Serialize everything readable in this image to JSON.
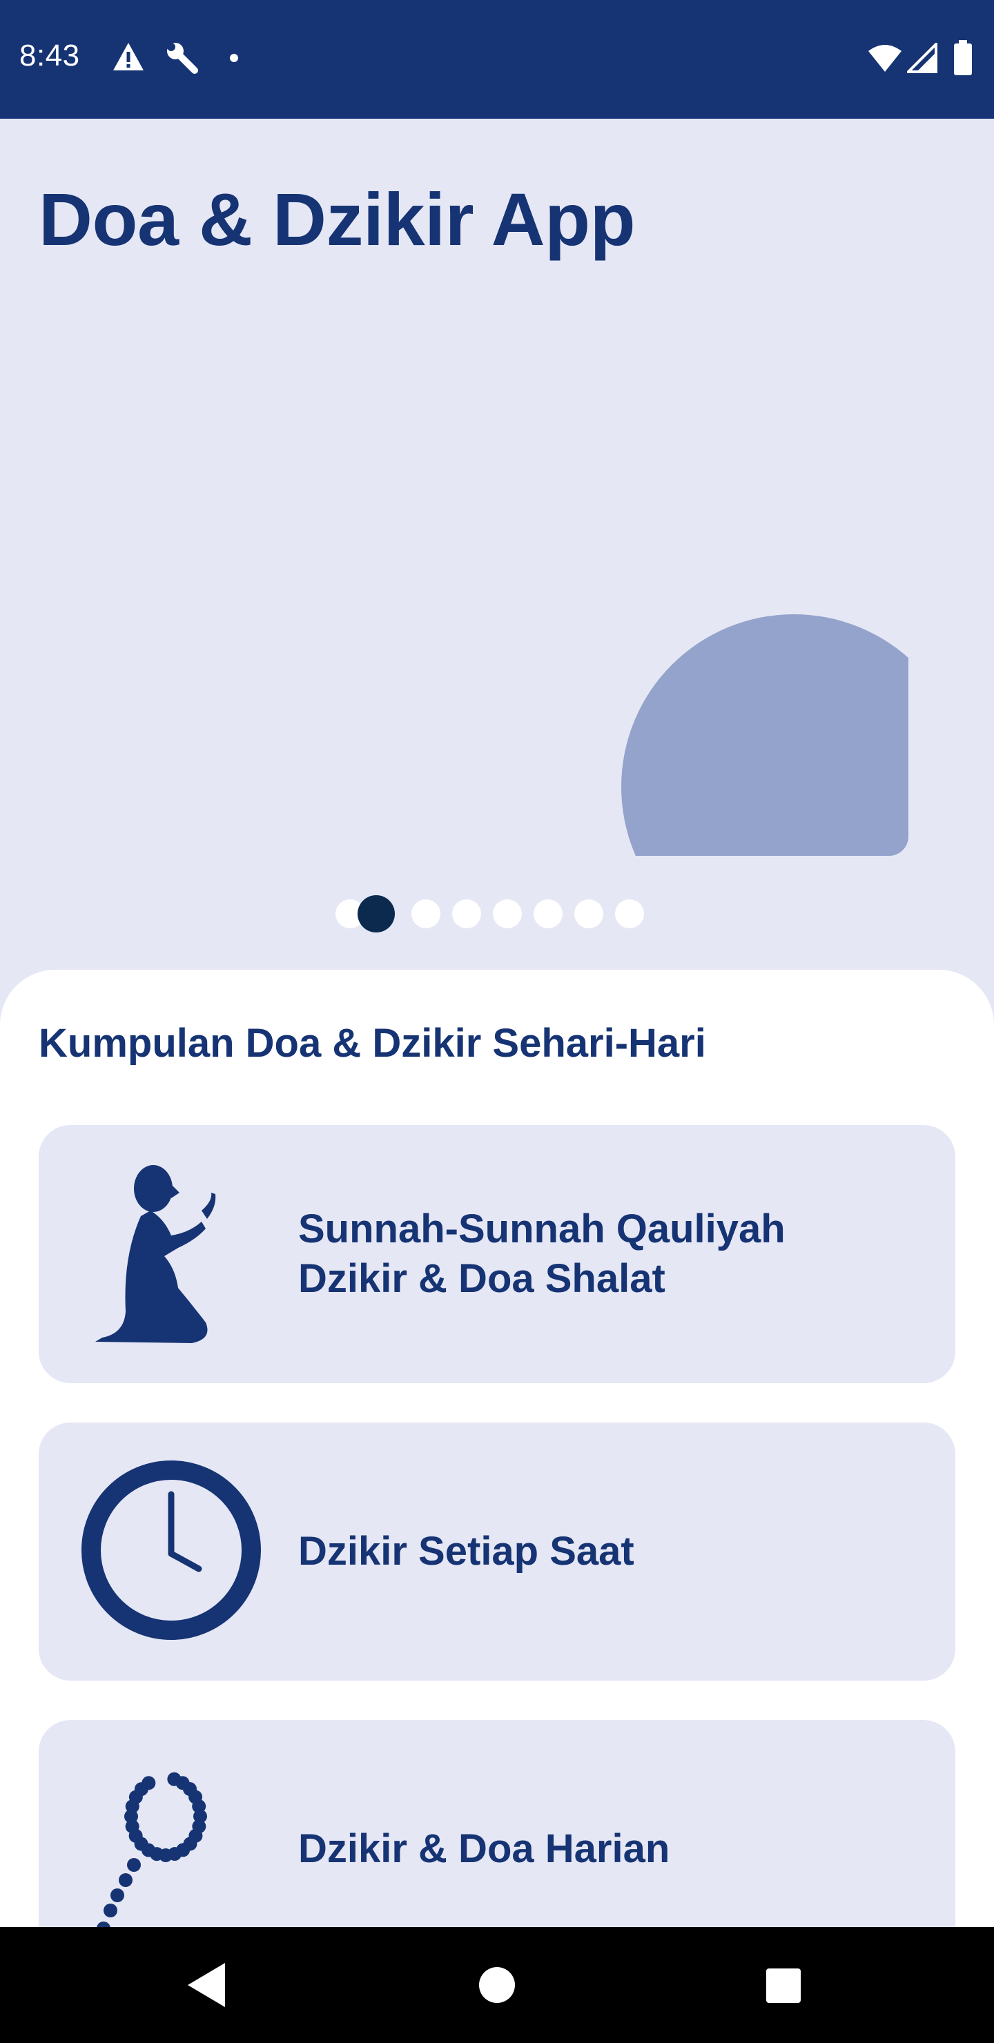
{
  "status_bar": {
    "time": "8:43",
    "left_icons": [
      "warning-icon",
      "wrench-icon",
      "dot-icon"
    ],
    "right_icons": [
      "wifi-icon",
      "signal-icon",
      "battery-icon"
    ]
  },
  "header": {
    "title": "Doa & Dzikir App"
  },
  "carousel": {
    "total_pages": 8,
    "active_index": 1
  },
  "section": {
    "title": "Kumpulan Doa & Dzikir Sehari-Hari"
  },
  "cards": [
    {
      "icon": "praying-person-icon",
      "line1": "Sunnah-Sunnah Qauliyah",
      "line2": "Dzikir & Doa Shalat"
    },
    {
      "icon": "clock-icon",
      "line1": "Dzikir Setiap Saat"
    },
    {
      "icon": "prayer-beads-icon",
      "line1": "Dzikir & Doa Harian"
    }
  ],
  "nav": {
    "buttons": [
      "back-icon",
      "home-icon",
      "recents-icon"
    ]
  },
  "colors": {
    "primary": "#163473",
    "background": "#e6e7f5",
    "hero_shape": "#93a3cb",
    "dot_active": "#0b2a4d"
  }
}
